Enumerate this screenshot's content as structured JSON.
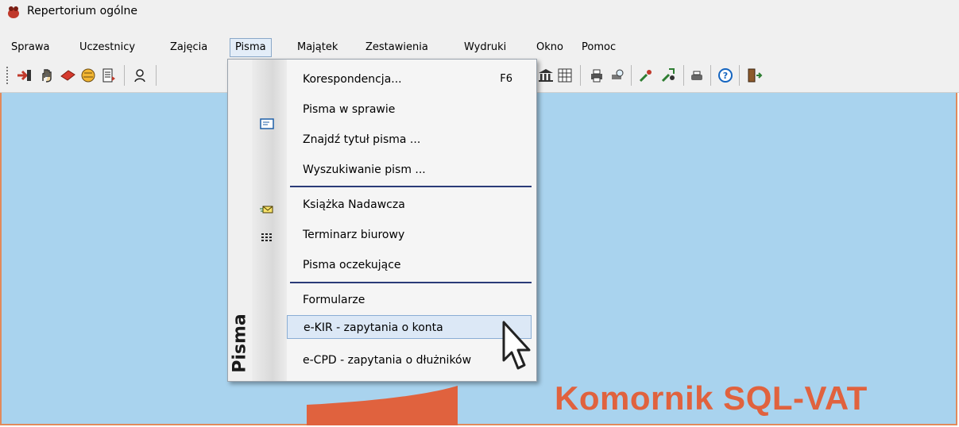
{
  "window": {
    "title": "Repertorium ogólne"
  },
  "menubar": [
    {
      "label": "Sprawa",
      "active": false
    },
    {
      "label": "Uczestnicy",
      "active": false
    },
    {
      "label": "Zajęcia",
      "active": false
    },
    {
      "label": "Pisma",
      "active": true
    },
    {
      "label": "Majątek",
      "active": false
    },
    {
      "label": "Zestawienia",
      "active": false
    },
    {
      "label": "Wydruki",
      "active": false
    },
    {
      "label": "Okno",
      "active": false
    },
    {
      "label": "Pomoc",
      "active": false
    }
  ],
  "dropdown": {
    "sidebar_title": "Pisma",
    "items": [
      {
        "label": "Korespondencja...",
        "shortcut": "F6",
        "icon": "letter-icon"
      },
      {
        "label": "Pisma w sprawie"
      },
      {
        "label": "Znajdź tytuł pisma ..."
      },
      {
        "label": "Wyszukiwanie pism ..."
      },
      {
        "label": "Książka Nadawcza",
        "icon": "envelope-icon"
      },
      {
        "label": "Terminarz biurowy",
        "icon": "grid-icon"
      },
      {
        "label": "Pisma oczekujące"
      },
      {
        "label": "Formularze"
      },
      {
        "label": "e-KIR - zapytania o konta",
        "highlighted": true
      },
      {
        "label": "e-CPD - zapytania o dłużników"
      }
    ]
  },
  "brand": {
    "text": "Komornik SQL-VAT"
  },
  "colors": {
    "desktop": "#a9d3ee",
    "brand": "#e0623e",
    "window_border": "#e28a5c",
    "separator": "#2b3b78",
    "highlight": "#dce8f6"
  }
}
